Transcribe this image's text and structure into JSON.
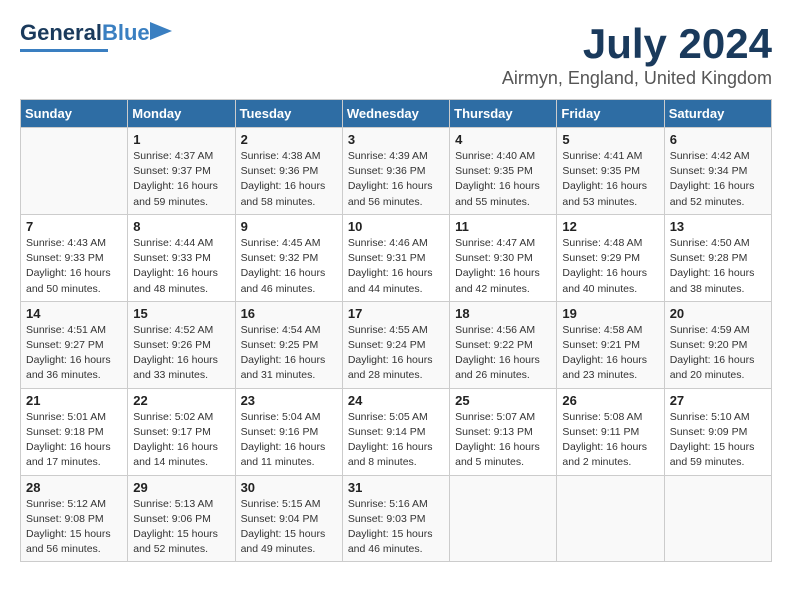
{
  "header": {
    "logo_line1": "General",
    "logo_line2": "Blue",
    "title": "July 2024",
    "subtitle": "Airmyn, England, United Kingdom"
  },
  "days_of_week": [
    "Sunday",
    "Monday",
    "Tuesday",
    "Wednesday",
    "Thursday",
    "Friday",
    "Saturday"
  ],
  "weeks": [
    [
      {
        "day": "",
        "info": ""
      },
      {
        "day": "1",
        "info": "Sunrise: 4:37 AM\nSunset: 9:37 PM\nDaylight: 16 hours\nand 59 minutes."
      },
      {
        "day": "2",
        "info": "Sunrise: 4:38 AM\nSunset: 9:36 PM\nDaylight: 16 hours\nand 58 minutes."
      },
      {
        "day": "3",
        "info": "Sunrise: 4:39 AM\nSunset: 9:36 PM\nDaylight: 16 hours\nand 56 minutes."
      },
      {
        "day": "4",
        "info": "Sunrise: 4:40 AM\nSunset: 9:35 PM\nDaylight: 16 hours\nand 55 minutes."
      },
      {
        "day": "5",
        "info": "Sunrise: 4:41 AM\nSunset: 9:35 PM\nDaylight: 16 hours\nand 53 minutes."
      },
      {
        "day": "6",
        "info": "Sunrise: 4:42 AM\nSunset: 9:34 PM\nDaylight: 16 hours\nand 52 minutes."
      }
    ],
    [
      {
        "day": "7",
        "info": "Sunrise: 4:43 AM\nSunset: 9:33 PM\nDaylight: 16 hours\nand 50 minutes."
      },
      {
        "day": "8",
        "info": "Sunrise: 4:44 AM\nSunset: 9:33 PM\nDaylight: 16 hours\nand 48 minutes."
      },
      {
        "day": "9",
        "info": "Sunrise: 4:45 AM\nSunset: 9:32 PM\nDaylight: 16 hours\nand 46 minutes."
      },
      {
        "day": "10",
        "info": "Sunrise: 4:46 AM\nSunset: 9:31 PM\nDaylight: 16 hours\nand 44 minutes."
      },
      {
        "day": "11",
        "info": "Sunrise: 4:47 AM\nSunset: 9:30 PM\nDaylight: 16 hours\nand 42 minutes."
      },
      {
        "day": "12",
        "info": "Sunrise: 4:48 AM\nSunset: 9:29 PM\nDaylight: 16 hours\nand 40 minutes."
      },
      {
        "day": "13",
        "info": "Sunrise: 4:50 AM\nSunset: 9:28 PM\nDaylight: 16 hours\nand 38 minutes."
      }
    ],
    [
      {
        "day": "14",
        "info": "Sunrise: 4:51 AM\nSunset: 9:27 PM\nDaylight: 16 hours\nand 36 minutes."
      },
      {
        "day": "15",
        "info": "Sunrise: 4:52 AM\nSunset: 9:26 PM\nDaylight: 16 hours\nand 33 minutes."
      },
      {
        "day": "16",
        "info": "Sunrise: 4:54 AM\nSunset: 9:25 PM\nDaylight: 16 hours\nand 31 minutes."
      },
      {
        "day": "17",
        "info": "Sunrise: 4:55 AM\nSunset: 9:24 PM\nDaylight: 16 hours\nand 28 minutes."
      },
      {
        "day": "18",
        "info": "Sunrise: 4:56 AM\nSunset: 9:22 PM\nDaylight: 16 hours\nand 26 minutes."
      },
      {
        "day": "19",
        "info": "Sunrise: 4:58 AM\nSunset: 9:21 PM\nDaylight: 16 hours\nand 23 minutes."
      },
      {
        "day": "20",
        "info": "Sunrise: 4:59 AM\nSunset: 9:20 PM\nDaylight: 16 hours\nand 20 minutes."
      }
    ],
    [
      {
        "day": "21",
        "info": "Sunrise: 5:01 AM\nSunset: 9:18 PM\nDaylight: 16 hours\nand 17 minutes."
      },
      {
        "day": "22",
        "info": "Sunrise: 5:02 AM\nSunset: 9:17 PM\nDaylight: 16 hours\nand 14 minutes."
      },
      {
        "day": "23",
        "info": "Sunrise: 5:04 AM\nSunset: 9:16 PM\nDaylight: 16 hours\nand 11 minutes."
      },
      {
        "day": "24",
        "info": "Sunrise: 5:05 AM\nSunset: 9:14 PM\nDaylight: 16 hours\nand 8 minutes."
      },
      {
        "day": "25",
        "info": "Sunrise: 5:07 AM\nSunset: 9:13 PM\nDaylight: 16 hours\nand 5 minutes."
      },
      {
        "day": "26",
        "info": "Sunrise: 5:08 AM\nSunset: 9:11 PM\nDaylight: 16 hours\nand 2 minutes."
      },
      {
        "day": "27",
        "info": "Sunrise: 5:10 AM\nSunset: 9:09 PM\nDaylight: 15 hours\nand 59 minutes."
      }
    ],
    [
      {
        "day": "28",
        "info": "Sunrise: 5:12 AM\nSunset: 9:08 PM\nDaylight: 15 hours\nand 56 minutes."
      },
      {
        "day": "29",
        "info": "Sunrise: 5:13 AM\nSunset: 9:06 PM\nDaylight: 15 hours\nand 52 minutes."
      },
      {
        "day": "30",
        "info": "Sunrise: 5:15 AM\nSunset: 9:04 PM\nDaylight: 15 hours\nand 49 minutes."
      },
      {
        "day": "31",
        "info": "Sunrise: 5:16 AM\nSunset: 9:03 PM\nDaylight: 15 hours\nand 46 minutes."
      },
      {
        "day": "",
        "info": ""
      },
      {
        "day": "",
        "info": ""
      },
      {
        "day": "",
        "info": ""
      }
    ]
  ]
}
